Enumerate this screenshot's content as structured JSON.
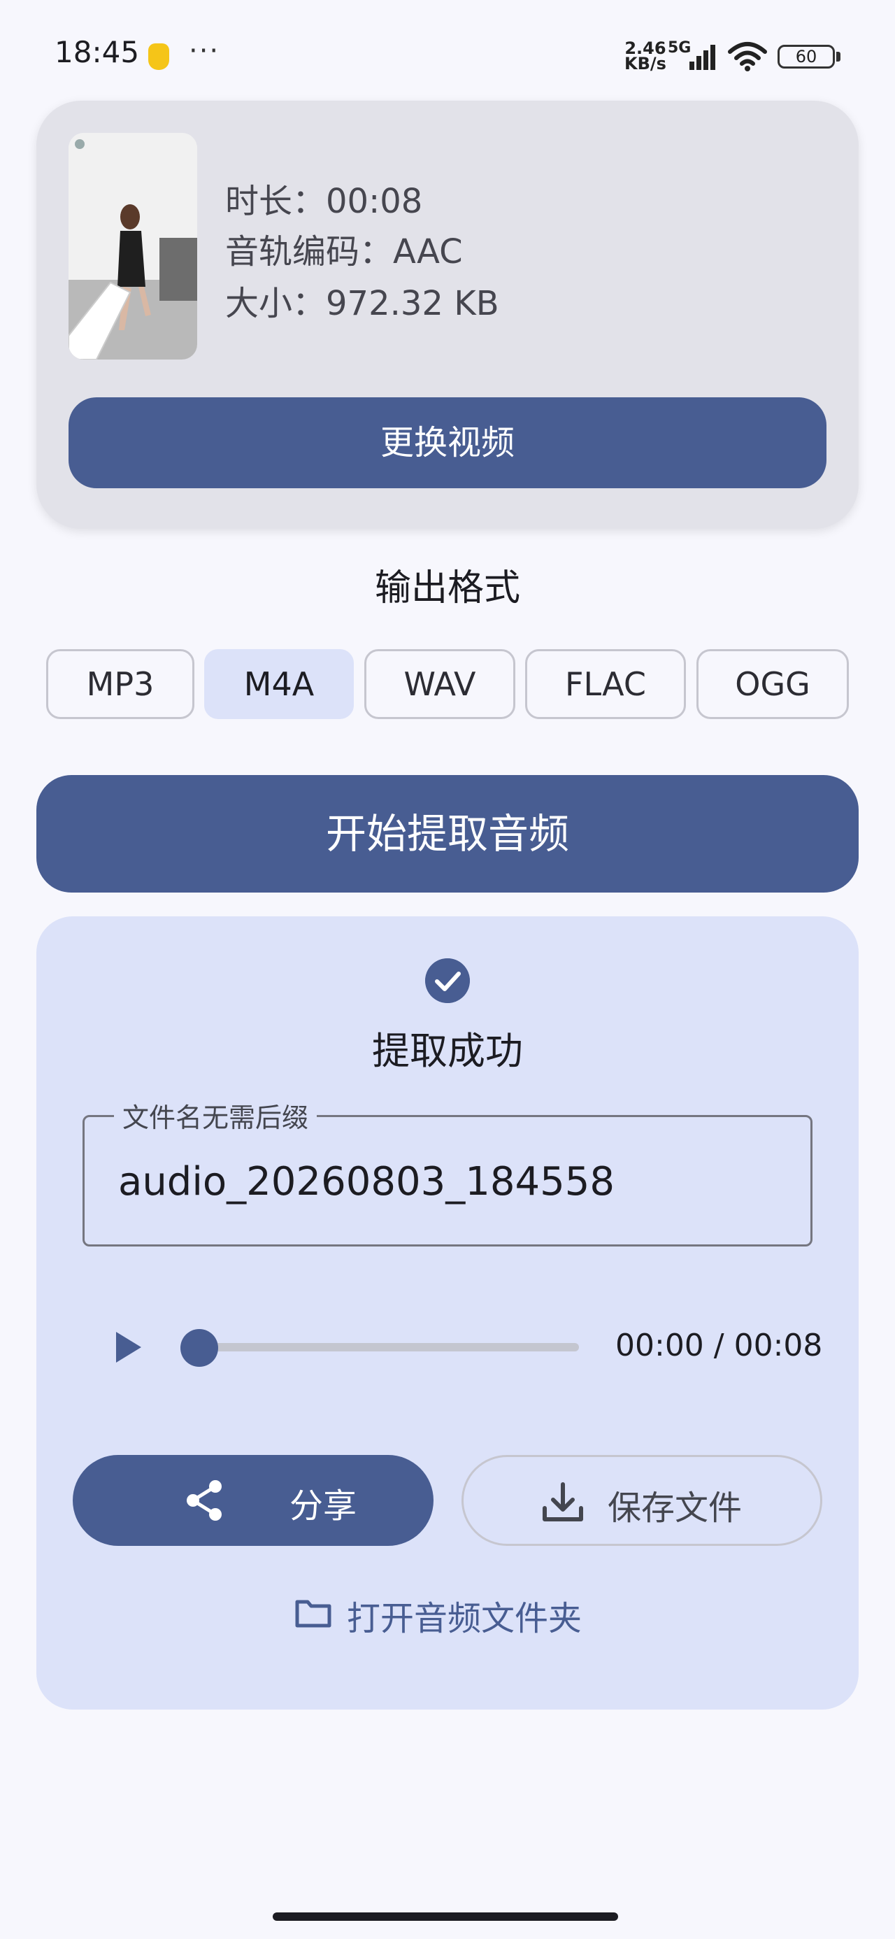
{
  "status_bar": {
    "time": "18:45",
    "more": "···",
    "net_speed_value": "2.46",
    "net_speed_unit": "KB/s",
    "network_type": "5G",
    "battery": "60"
  },
  "video_info": {
    "duration": "时长：00:08",
    "audio_codec": "音轨编码：AAC",
    "size": "大小：972.32 KB",
    "replace_button": "更换视频"
  },
  "output_format": {
    "title": "输出格式",
    "options": [
      "MP3",
      "M4A",
      "WAV",
      "FLAC",
      "OGG"
    ],
    "selected": "M4A"
  },
  "extract_button": "开始提取音频",
  "result": {
    "status": "提取成功",
    "filename_label": "文件名无需后缀",
    "filename_value": "audio_20260803_184558",
    "player_time": "00:00 / 00:08",
    "progress": 0,
    "share_button": "分享",
    "save_button": "保存文件",
    "open_folder": "打开音频文件夹"
  },
  "colors": {
    "primary": "#485d92",
    "card_bg": "#e2e2e9",
    "result_bg": "#dce2f9",
    "page_bg": "#f7f7fd"
  },
  "icons": [
    "signal-icon",
    "wifi-icon",
    "battery-icon",
    "check-circle-icon",
    "play-icon",
    "share-icon",
    "download-icon",
    "folder-icon"
  ]
}
